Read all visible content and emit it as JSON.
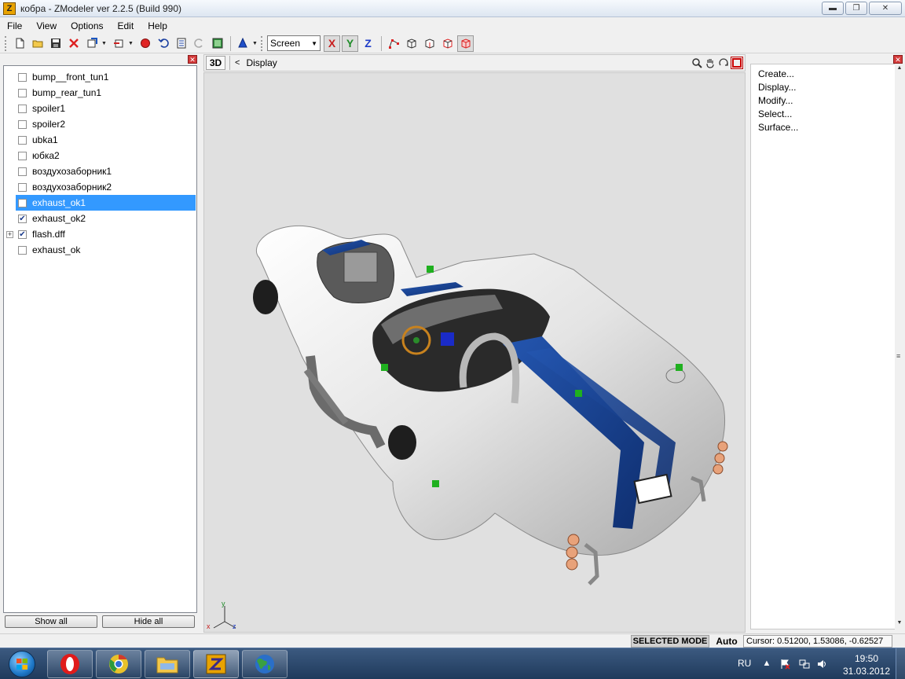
{
  "window": {
    "title": "кобра - ZModeler ver 2.2.5 (Build 990)",
    "app_icon_letter": "Z",
    "minimize_glyph": "▬",
    "maximize_glyph": "❐",
    "close_glyph": "✕"
  },
  "menu": [
    "File",
    "View",
    "Options",
    "Edit",
    "Help"
  ],
  "toolbar": {
    "view_select": "Screen",
    "axis_x": "X",
    "axis_y": "Y",
    "axis_z": "Z"
  },
  "object_tree": {
    "items": [
      {
        "label": "bump__front_tun1",
        "checked": false,
        "selected": false,
        "expandable": false
      },
      {
        "label": "bump_rear_tun1",
        "checked": false,
        "selected": false,
        "expandable": false
      },
      {
        "label": "spoiler1",
        "checked": false,
        "selected": false,
        "expandable": false
      },
      {
        "label": "spoiler2",
        "checked": false,
        "selected": false,
        "expandable": false
      },
      {
        "label": "ubka1",
        "checked": false,
        "selected": false,
        "expandable": false
      },
      {
        "label": "юбка2",
        "checked": false,
        "selected": false,
        "expandable": false
      },
      {
        "label": "воздухозаборник1",
        "checked": false,
        "selected": false,
        "expandable": false
      },
      {
        "label": "воздухозаборник2",
        "checked": false,
        "selected": false,
        "expandable": false
      },
      {
        "label": "exhaust_ok1",
        "checked": false,
        "selected": true,
        "expandable": false
      },
      {
        "label": "exhaust_ok2",
        "checked": true,
        "selected": false,
        "expandable": false
      },
      {
        "label": "flash.dff",
        "checked": true,
        "selected": false,
        "expandable": true
      },
      {
        "label": "exhaust_ok",
        "checked": false,
        "selected": false,
        "expandable": false
      }
    ],
    "show_all": "Show all",
    "hide_all": "Hide all"
  },
  "viewport": {
    "mode_label": "3D",
    "back_glyph": "<",
    "title": "Display",
    "axis_labels": {
      "x": "x",
      "y": "y",
      "z": "z"
    },
    "colors": {
      "background": "#e0e0e0",
      "car_body": "#eeeeee",
      "stripe": "#1a3f8f"
    }
  },
  "commands": [
    "Create...",
    "Display...",
    "Modify...",
    "Select...",
    "Surface..."
  ],
  "status": {
    "mode": "SELECTED MODE",
    "auto": "Auto",
    "cursor": "Cursor: 0.51200, 1.53086, -0.62527"
  },
  "taskbar": {
    "apps": [
      {
        "name": "opera",
        "glyph": "O",
        "active": false
      },
      {
        "name": "chrome",
        "glyph": "",
        "active": false
      },
      {
        "name": "explorer",
        "glyph": "",
        "active": false
      },
      {
        "name": "zmodeler",
        "glyph": "Z",
        "active": true
      },
      {
        "name": "globe",
        "glyph": "",
        "active": false
      }
    ],
    "tray": {
      "language": "RU",
      "time": "19:50",
      "date": "31.03.2012"
    }
  }
}
